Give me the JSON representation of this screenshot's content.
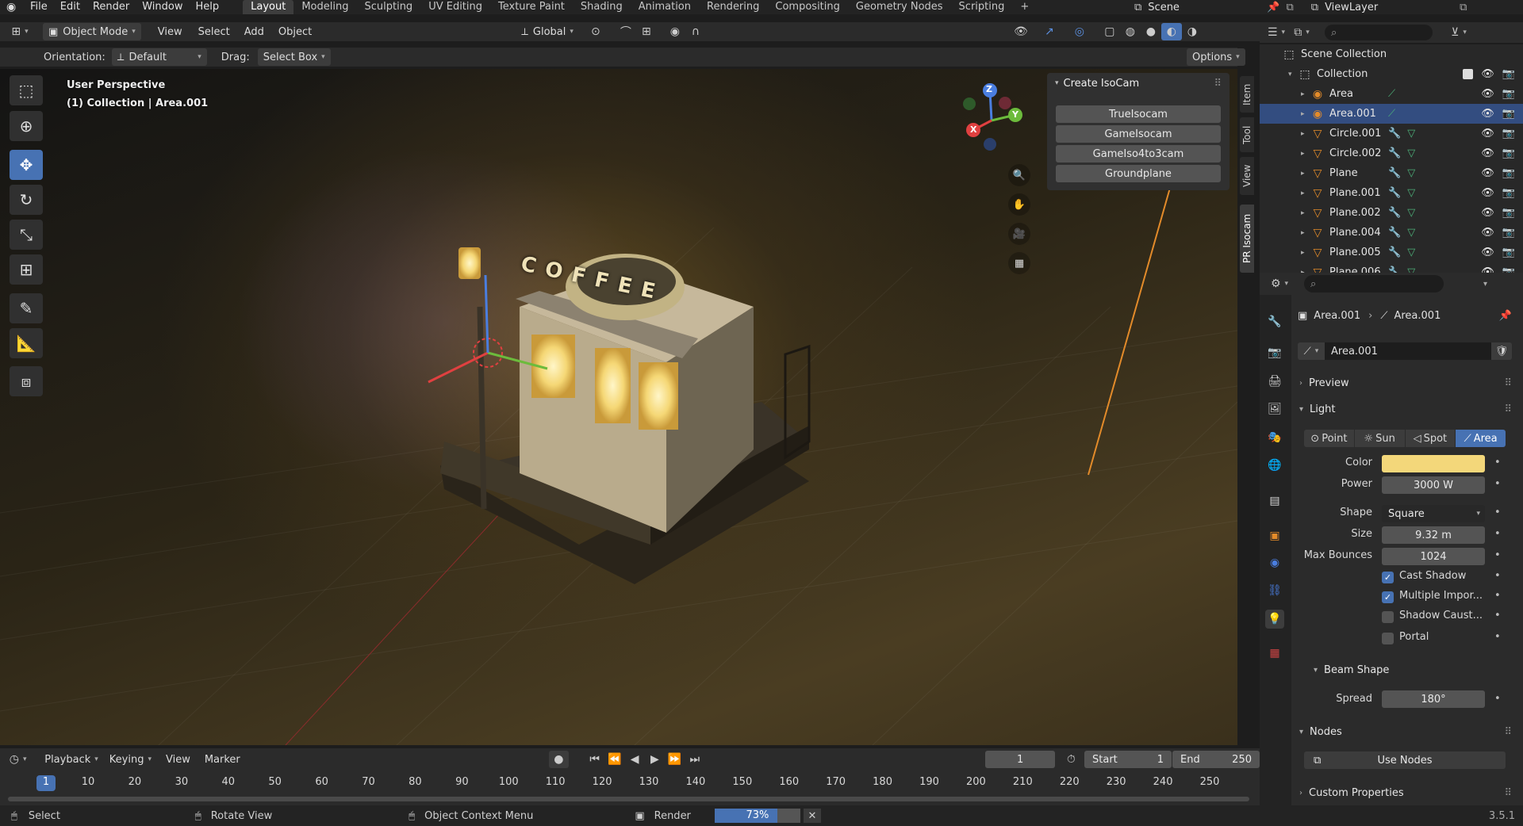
{
  "menubar": {
    "menus": [
      "File",
      "Edit",
      "Render",
      "Window",
      "Help"
    ],
    "workspaces": [
      "Layout",
      "Modeling",
      "Sculpting",
      "UV Editing",
      "Texture Paint",
      "Shading",
      "Animation",
      "Rendering",
      "Compositing",
      "Geometry Nodes",
      "Scripting"
    ],
    "active_workspace": "Layout",
    "plus": "+",
    "scene": "Scene",
    "view_layer": "ViewLayer"
  },
  "vp_header": {
    "mode": "Object Mode",
    "menus": [
      "View",
      "Select",
      "Add",
      "Object"
    ],
    "transform": "Global"
  },
  "tool_header": {
    "orientation_label": "Orientation:",
    "orientation_value": "Default",
    "drag_label": "Drag:",
    "drag_value": "Select Box",
    "options": "Options"
  },
  "viewport": {
    "perspective": "User Perspective",
    "context": "(1) Collection | Area.001",
    "sign_text": "COFFEE",
    "gizmo": {
      "z": "Z",
      "y": "Y",
      "x": "X"
    }
  },
  "npanel": {
    "title": "Create IsoCam",
    "buttons": [
      "TrueIsocam",
      "GameIsocam",
      "GameIso4to3cam",
      "Groundplane"
    ]
  },
  "side_tabs": [
    "Item",
    "Tool",
    "View",
    "PR Isocam"
  ],
  "outliner": {
    "root": "Scene Collection",
    "collection": "Collection",
    "items": [
      "Area",
      "Area.001",
      "Circle.001",
      "Circle.002",
      "Plane",
      "Plane.001",
      "Plane.002",
      "Plane.004",
      "Plane.005",
      "Plane.006"
    ],
    "selected": "Area.001"
  },
  "props": {
    "breadcrumb_obj": "Area.001",
    "breadcrumb_data": "Area.001",
    "datablock": "Area.001",
    "sections": {
      "preview": "Preview",
      "light": "Light",
      "beam": "Beam Shape",
      "nodes": "Nodes",
      "custom": "Custom Properties"
    },
    "light_types": [
      "Point",
      "Sun",
      "Spot",
      "Area"
    ],
    "active_type": "Area",
    "color_label": "Color",
    "color_value": "#f3d77a",
    "power_label": "Power",
    "power": "3000 W",
    "shape_label": "Shape",
    "shape": "Square",
    "size_label": "Size",
    "size": "9.32 m",
    "bounces_label": "Max Bounces",
    "bounces": "1024",
    "checks": [
      {
        "label": "Cast Shadow",
        "on": true
      },
      {
        "label": "Multiple Impor...",
        "on": true
      },
      {
        "label": "Shadow Caust...",
        "on": false
      },
      {
        "label": "Portal",
        "on": false
      }
    ],
    "spread_label": "Spread",
    "spread": "180°",
    "use_nodes": "Use Nodes"
  },
  "timeline": {
    "menus": [
      "Playback",
      "Keying",
      "View",
      "Marker"
    ],
    "current_frame": "1",
    "start_label": "Start",
    "start": "1",
    "end_label": "End",
    "end": "250",
    "ticks": [
      "1",
      "10",
      "20",
      "30",
      "40",
      "50",
      "60",
      "70",
      "80",
      "90",
      "100",
      "110",
      "120",
      "130",
      "140",
      "150",
      "160",
      "170",
      "180",
      "190",
      "200",
      "210",
      "220",
      "230",
      "240",
      "250"
    ]
  },
  "status": {
    "select": "Select",
    "rotate": "Rotate View",
    "context_menu": "Object Context Menu",
    "render": "Render",
    "progress": "73%",
    "version": "3.5.1",
    "progress_value": 0.73
  }
}
